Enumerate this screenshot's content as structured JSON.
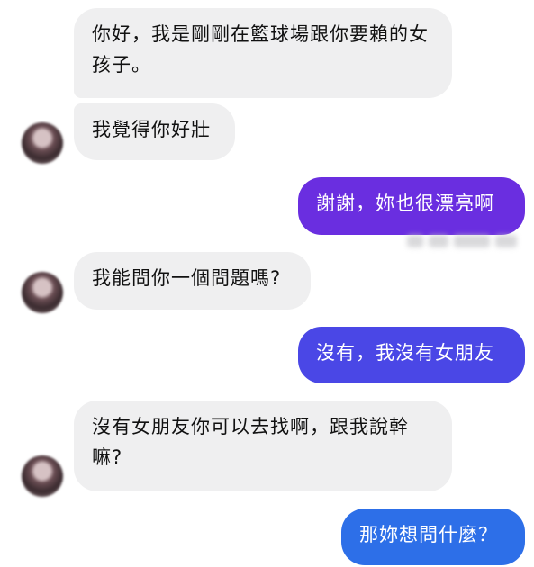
{
  "chat": {
    "m1": "你好，我是剛剛在籃球場跟你要賴的女孩子。",
    "m2": "我覺得你好壯",
    "m3": "謝謝，妳也很漂亮啊",
    "m4": "我能問你一個問題嗎?",
    "m5": "沒有，我沒有女朋友",
    "m6": "沒有女朋友你可以去找啊，跟我說幹嘛?",
    "m7": "那妳想問什麼？"
  },
  "colors": {
    "incoming_bubble": "#efeff0",
    "outgoing_purple": "#6a2ee0",
    "outgoing_indigo": "#4a47e6",
    "outgoing_blue": "#2d6fe8"
  }
}
